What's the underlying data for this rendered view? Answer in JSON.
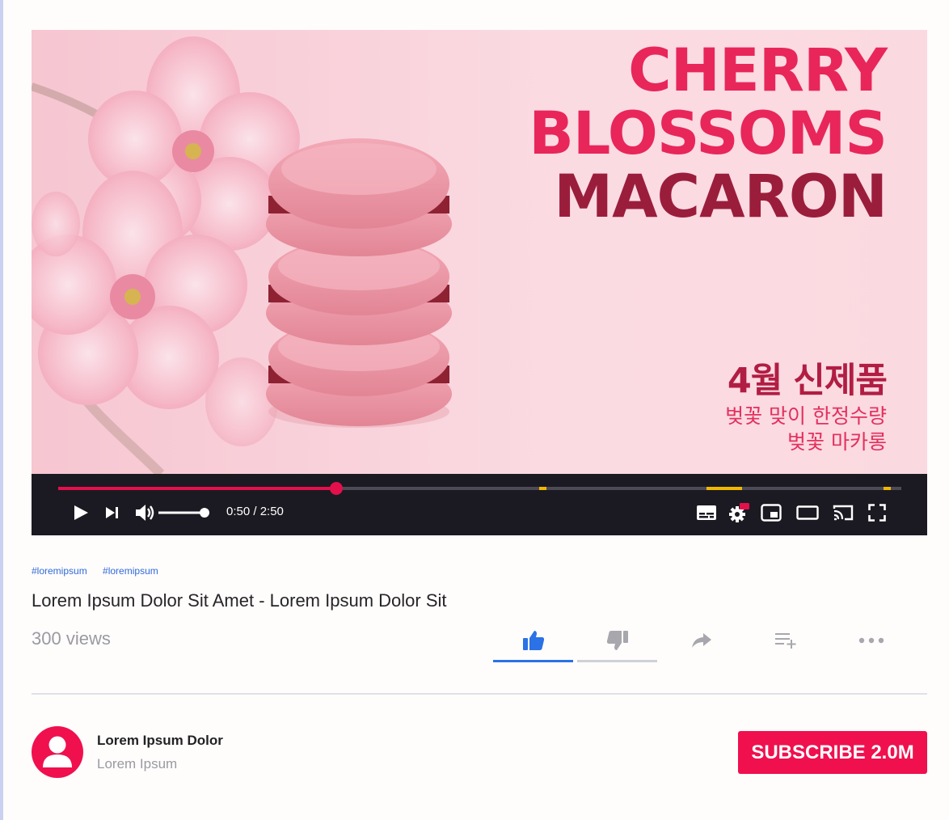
{
  "video": {
    "thumbnail_title": [
      "CHERRY",
      "BLOSSOMS",
      "MACARON"
    ],
    "thumbnail_korean": [
      "4월 신제품",
      "벚꽃 맞이 한정수량",
      "벚꽃 마카롱"
    ],
    "progress_fraction": 0.33,
    "current_time": "0:50",
    "duration": "2:50",
    "time_display": "0:50 / 2:50",
    "volume_fraction": 1.0,
    "colors": {
      "progress": "#e3104b",
      "ad_marker": "#f2b800"
    },
    "controls": [
      "play-icon",
      "next-icon",
      "volume-icon",
      "captions-icon",
      "settings-hd-icon",
      "miniplayer-icon",
      "theater-icon",
      "cast-icon",
      "fullscreen-icon"
    ],
    "settings_badge": "HD"
  },
  "info": {
    "tags": [
      "#loremipsum",
      "#loremipsum"
    ],
    "title": "Lorem Ipsum Dolor Sit Amet - Lorem Ipsum Dolor Sit",
    "views": "300 views",
    "actions": [
      "like-icon",
      "dislike-icon",
      "share-icon",
      "add-to-playlist-icon",
      "more-icon"
    ],
    "like_ratio": 1.0
  },
  "channel": {
    "name": "Lorem Ipsum Dolor",
    "subtitle": "Lorem Ipsum",
    "subscribe_label": "SUBSCRIBE 2.0M",
    "accent": "#f0104e"
  }
}
